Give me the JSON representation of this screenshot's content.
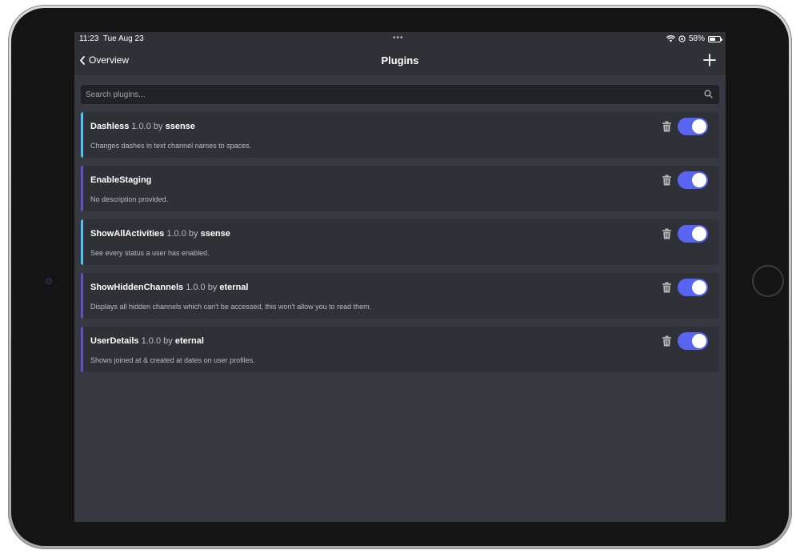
{
  "status_bar": {
    "time": "11:23",
    "date": "Tue Aug 23",
    "dots": "•••",
    "battery_percent": "58%",
    "battery_level": 0.58
  },
  "nav": {
    "back_label": "Overview",
    "title": "Plugins"
  },
  "search": {
    "placeholder": "Search plugins..."
  },
  "colors": {
    "accent_blue": "#5865f2",
    "accent_cyan": "#4fc3f7",
    "accent_purple": "#5b54c9",
    "background": "#36393f",
    "card": "#2f3136"
  },
  "plugins": [
    {
      "name": "Dashless",
      "version": "1.0.0",
      "by": "by",
      "author": "ssense",
      "description": "Changes dashes in text channel names to spaces.",
      "enabled": true,
      "accent": "#4fc3f7"
    },
    {
      "name": "EnableStaging",
      "version": "",
      "by": "",
      "author": "",
      "description": "No description provided.",
      "enabled": true,
      "accent": "#5b54c9"
    },
    {
      "name": "ShowAllActivities",
      "version": "1.0.0",
      "by": "by",
      "author": "ssense",
      "description": "See every status a user has enabled.",
      "enabled": true,
      "accent": "#4fc3f7"
    },
    {
      "name": "ShowHiddenChannels",
      "version": "1.0.0",
      "by": "by",
      "author": "eternal",
      "description": "Displays all hidden channels which can't be accessed, this won't allow you to read them.",
      "enabled": true,
      "accent": "#5b54c9"
    },
    {
      "name": "UserDetails",
      "version": "1.0.0",
      "by": "by",
      "author": "eternal",
      "description": "Shows joined at & created at dates on user profiles.",
      "enabled": true,
      "accent": "#5b54c9"
    }
  ]
}
